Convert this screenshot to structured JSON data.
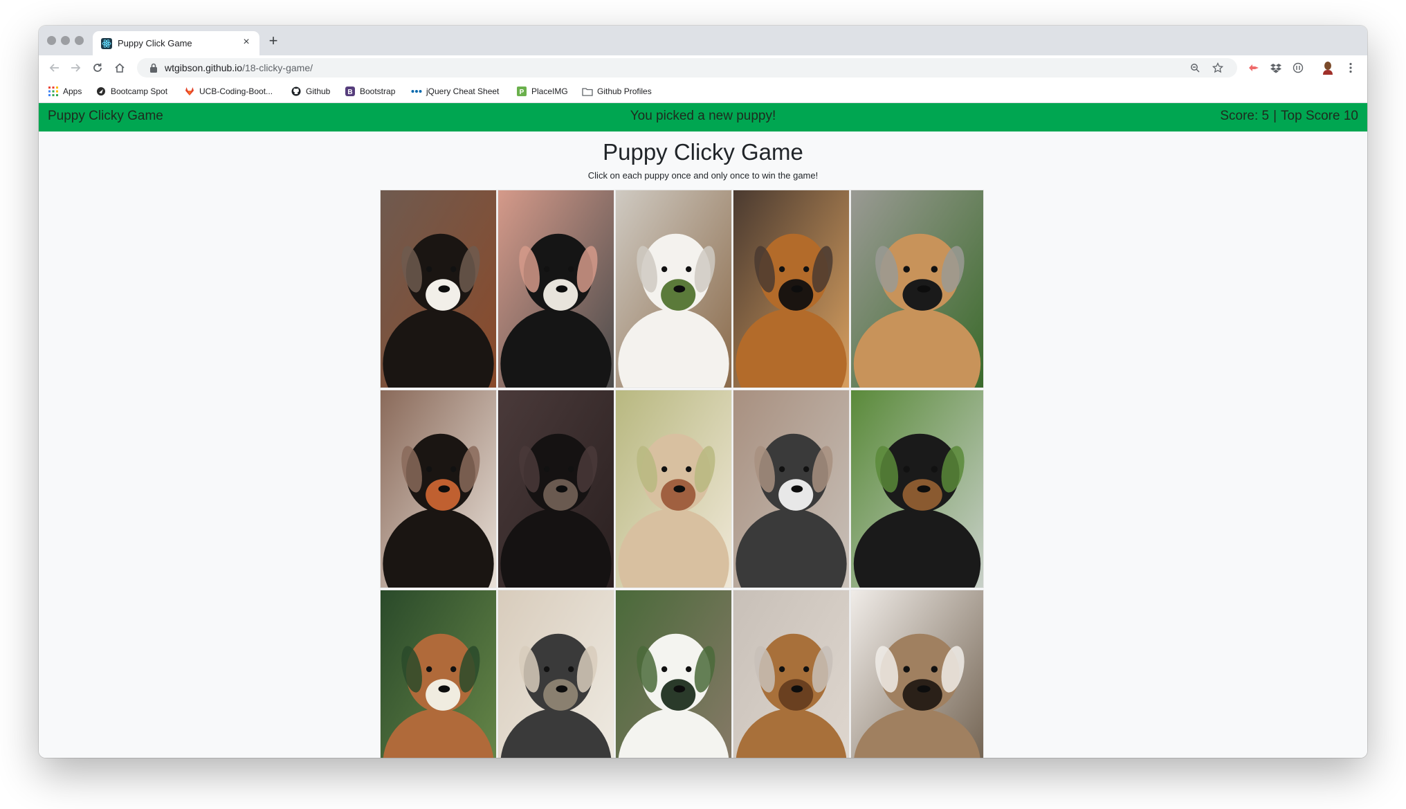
{
  "browser": {
    "tab": {
      "title": "Puppy Click Game",
      "close_glyph": "×"
    },
    "new_tab_glyph": "+",
    "url": {
      "host": "wtgibson.github.io",
      "path": "/18-clicky-game/"
    },
    "bookmarks": [
      {
        "label": "Apps",
        "icon": "apps-grid-icon"
      },
      {
        "label": "Bootcamp Spot",
        "icon": "bootcamp-icon"
      },
      {
        "label": "UCB-Coding-Boot...",
        "icon": "gitlab-icon"
      },
      {
        "label": "Github",
        "icon": "github-icon"
      },
      {
        "label": "Bootstrap",
        "icon": "bootstrap-icon"
      },
      {
        "label": "jQuery Cheat Sheet",
        "icon": "jquery-icon"
      },
      {
        "label": "PlaceIMG",
        "icon": "placeimg-icon"
      },
      {
        "label": "Github Profiles",
        "icon": "folder-icon"
      }
    ]
  },
  "navbar": {
    "brand": "Puppy Clicky Game",
    "message": "You picked a new puppy!",
    "score_label": "Score: 5",
    "separator": "|",
    "top_score_label": "Top Score 10"
  },
  "header": {
    "title": "Puppy Clicky Game",
    "instructions": "Click on each puppy once and only once to win the game!"
  },
  "puppies": [
    {
      "name": "bernese-mountain-dog",
      "colors": [
        "#6f5a4f",
        "#1a1512",
        "#f2efe9",
        "#8a4a2a"
      ]
    },
    {
      "name": "black-white-dog-with-tag",
      "colors": [
        "#d59a8a",
        "#151515",
        "#e8e4dc",
        "#4a4a4a"
      ]
    },
    {
      "name": "white-poodle-by-window",
      "colors": [
        "#cfcac2",
        "#f4f2ee",
        "#5b7a3a",
        "#8a6a4a"
      ]
    },
    {
      "name": "akita-shepherd-puppy",
      "colors": [
        "#4a3a30",
        "#b36b2a",
        "#1a1410",
        "#d8a060"
      ]
    },
    {
      "name": "puggle-with-bandana",
      "colors": [
        "#9a9a94",
        "#c8935a",
        "#1a1a1a",
        "#3a6a2a"
      ]
    },
    {
      "name": "swiss-mountain-puppy",
      "colors": [
        "#8a6a5a",
        "#1a1512",
        "#c06030",
        "#e8e0d8"
      ]
    },
    {
      "name": "cocker-spaniel-dark",
      "colors": [
        "#4a3a3a",
        "#151212",
        "#6a5a50",
        "#2a2020"
      ]
    },
    {
      "name": "saluki-in-garden",
      "colors": [
        "#b8b880",
        "#d8c0a0",
        "#a06040",
        "#f0e8d8"
      ]
    },
    {
      "name": "schnauzer-mix-grey",
      "colors": [
        "#a89080",
        "#3a3a3a",
        "#e8e8e8",
        "#c8c0b8"
      ]
    },
    {
      "name": "brussels-griffon",
      "colors": [
        "#5a8a3a",
        "#1a1a1a",
        "#8a5a30",
        "#c8d0c8"
      ]
    },
    {
      "name": "yorkie-in-flowers",
      "colors": [
        "#2a4a2a",
        "#b06a3a",
        "#f0ece0",
        "#6a8a4a"
      ]
    },
    {
      "name": "fluffy-pup-on-deck",
      "colors": [
        "#d8ccbc",
        "#3a3a3a",
        "#8a8070",
        "#f0ece4"
      ]
    },
    {
      "name": "white-pup-on-grass",
      "colors": [
        "#4a6a3a",
        "#f4f4f0",
        "#2a3a2a",
        "#8a7a6a"
      ]
    },
    {
      "name": "airedale-terrier",
      "colors": [
        "#c8c0b8",
        "#a8703a",
        "#6a4020",
        "#e0d8d0"
      ]
    },
    {
      "name": "border-terrier",
      "colors": [
        "#f0ece8",
        "#a08060",
        "#2a2018",
        "#6a5a48"
      ]
    }
  ],
  "colors": {
    "navbar_bg": "#00a651",
    "page_bg": "#f8f9fa",
    "text": "#212529"
  }
}
